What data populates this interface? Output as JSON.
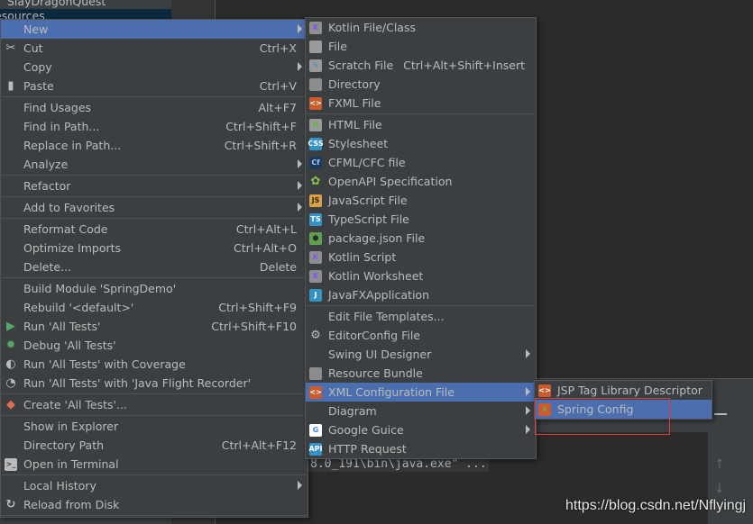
{
  "project_tree": {
    "item1": "SlayDragonQuest",
    "item2": "esources"
  },
  "console": {
    "text": "8.0_191\\bin\\java.exe\" ..."
  },
  "watermark": "https://blog.csdn.net/Nflyingj",
  "colors": {
    "menu_bg": "#3c3f41",
    "selection": "#4b6eaf",
    "highlight_box": "#e03c3c"
  },
  "context_menu": [
    {
      "label": "New",
      "submenu": true,
      "selected": true
    },
    {
      "label": "Cut",
      "shortcut": "Ctrl+X",
      "icon": "scissors-icon"
    },
    {
      "label": "Copy",
      "submenu": true
    },
    {
      "label": "Paste",
      "shortcut": "Ctrl+V",
      "icon": "clipboard-icon"
    },
    {
      "sep": true
    },
    {
      "label": "Find Usages",
      "shortcut": "Alt+F7"
    },
    {
      "label": "Find in Path...",
      "shortcut": "Ctrl+Shift+F"
    },
    {
      "label": "Replace in Path...",
      "shortcut": "Ctrl+Shift+R"
    },
    {
      "label": "Analyze",
      "submenu": true
    },
    {
      "sep": true
    },
    {
      "label": "Refactor",
      "submenu": true
    },
    {
      "sep": true
    },
    {
      "label": "Add to Favorites",
      "submenu": true
    },
    {
      "sep": true
    },
    {
      "label": "Reformat Code",
      "shortcut": "Ctrl+Alt+L"
    },
    {
      "label": "Optimize Imports",
      "shortcut": "Ctrl+Alt+O"
    },
    {
      "label": "Delete...",
      "shortcut": "Delete"
    },
    {
      "sep": true
    },
    {
      "label": "Build Module 'SpringDemo'"
    },
    {
      "label": "Rebuild '<default>'",
      "shortcut": "Ctrl+Shift+F9"
    },
    {
      "label": "Run 'All Tests'",
      "shortcut": "Ctrl+Shift+F10",
      "icon": "run-icon"
    },
    {
      "label": "Debug 'All Tests'",
      "icon": "debug-icon"
    },
    {
      "label": "Run 'All Tests' with Coverage",
      "icon": "coverage-icon"
    },
    {
      "label": "Run 'All Tests' with 'Java Flight Recorder'",
      "icon": "flight-recorder-icon"
    },
    {
      "sep": true
    },
    {
      "label": "Create 'All Tests'...",
      "icon": "create-test-icon"
    },
    {
      "sep": true
    },
    {
      "label": "Show in Explorer"
    },
    {
      "label": "Directory Path",
      "shortcut": "Ctrl+Alt+F12"
    },
    {
      "label": "Open in Terminal",
      "icon": "terminal-icon"
    },
    {
      "sep": true
    },
    {
      "label": "Local History",
      "submenu": true
    },
    {
      "label": "Reload from Disk",
      "icon": "reload-icon"
    },
    {
      "sep": true
    }
  ],
  "new_submenu": [
    {
      "label": "Kotlin File/Class",
      "icon": "kotlin-file-icon"
    },
    {
      "label": "File",
      "icon": "file-icon"
    },
    {
      "label": "Scratch File",
      "shortcut": "Ctrl+Alt+Shift+Insert",
      "icon": "scratch-file-icon"
    },
    {
      "label": "Directory",
      "icon": "folder-icon"
    },
    {
      "label": "FXML File",
      "icon": "fxml-file-icon"
    },
    {
      "sep": true
    },
    {
      "label": "HTML File",
      "icon": "html-file-icon"
    },
    {
      "label": "Stylesheet",
      "icon": "css-file-icon"
    },
    {
      "label": "CFML/CFC file",
      "icon": "cfml-file-icon"
    },
    {
      "label": "OpenAPI Specification",
      "icon": "openapi-icon"
    },
    {
      "label": "JavaScript File",
      "icon": "javascript-file-icon"
    },
    {
      "label": "TypeScript File",
      "icon": "typescript-file-icon"
    },
    {
      "label": "package.json File",
      "icon": "nodejs-icon"
    },
    {
      "label": "Kotlin Script",
      "icon": "kotlin-script-icon"
    },
    {
      "label": "Kotlin Worksheet",
      "icon": "kotlin-worksheet-icon"
    },
    {
      "label": "JavaFXApplication",
      "icon": "javafx-icon"
    },
    {
      "sep": true
    },
    {
      "label": "Edit File Templates..."
    },
    {
      "label": "EditorConfig File",
      "icon": "gear-icon"
    },
    {
      "label": "Swing UI Designer",
      "submenu": true
    },
    {
      "label": "Resource Bundle",
      "icon": "resource-bundle-icon"
    },
    {
      "label": "XML Configuration File",
      "submenu": true,
      "selected": true,
      "icon": "xml-file-icon"
    },
    {
      "label": "Diagram",
      "submenu": true
    },
    {
      "label": "Google Guice",
      "submenu": true,
      "icon": "google-icon"
    },
    {
      "label": "HTTP Request",
      "icon": "http-request-icon"
    }
  ],
  "xml_submenu": [
    {
      "label": "JSP Tag Library Descriptor",
      "icon": "jsp-tag-icon"
    },
    {
      "label": "Spring Config",
      "selected": true,
      "icon": "spring-config-icon"
    }
  ]
}
